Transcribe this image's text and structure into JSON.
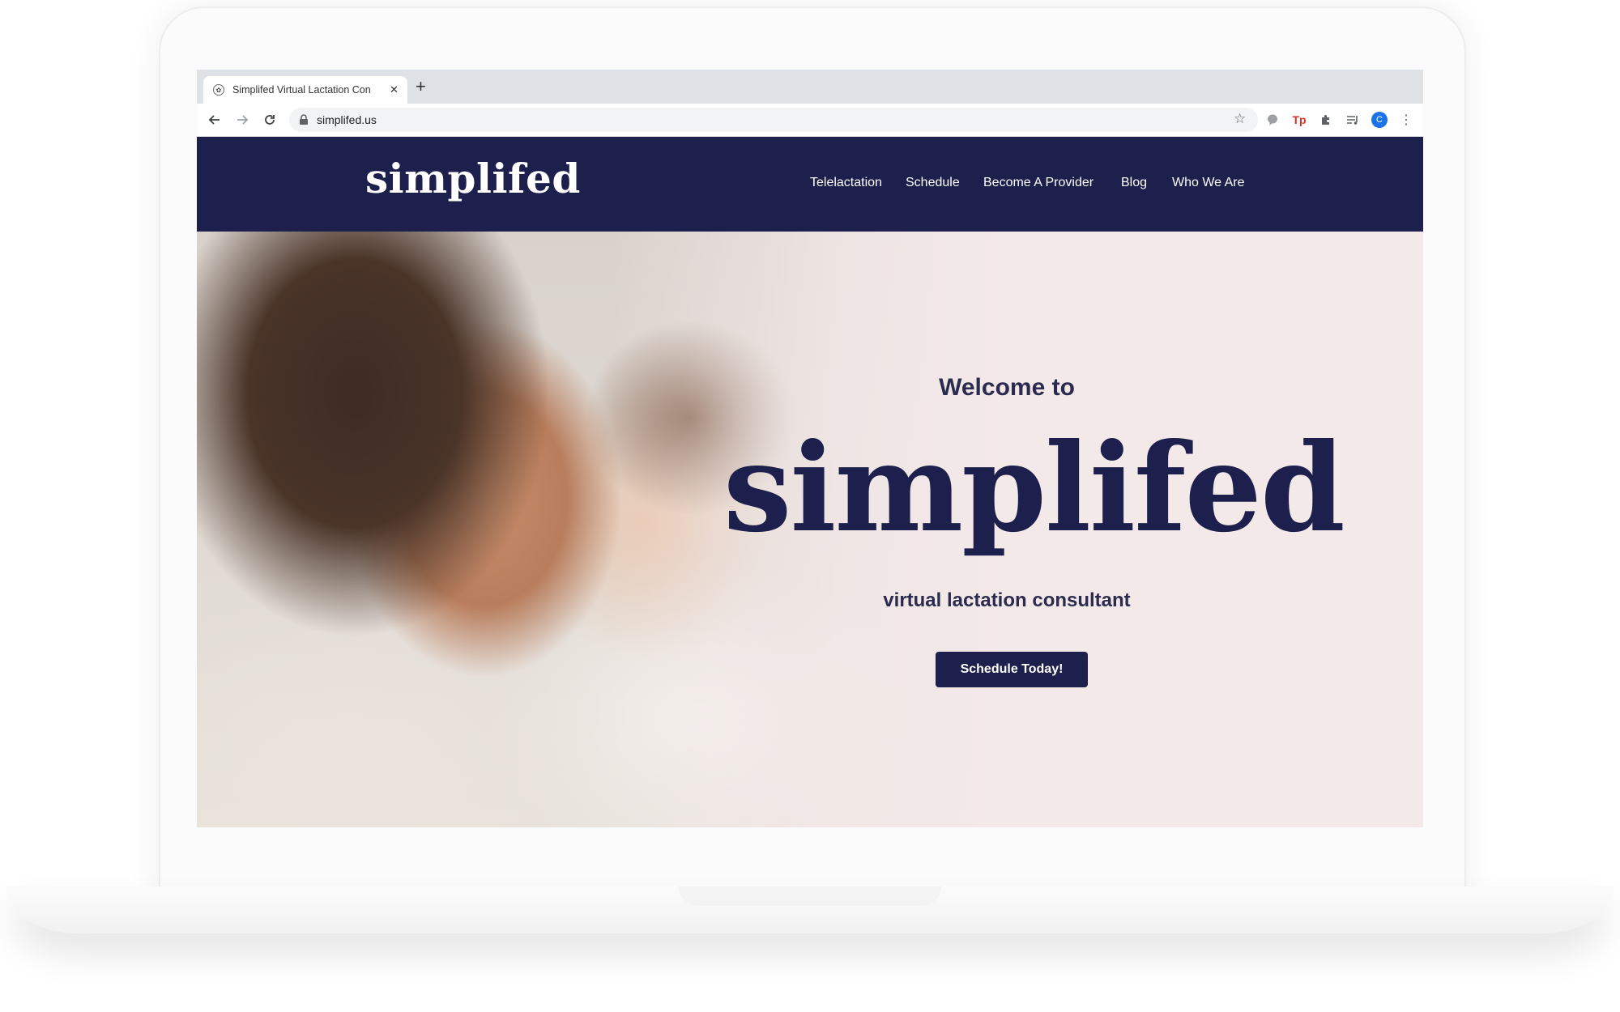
{
  "browser": {
    "tab_title": "Simplifed Virtual Lactation Con",
    "tab_close_glyph": "✕",
    "new_tab_glyph": "+",
    "url": "simplifed.us",
    "profile_initial": "C",
    "extensions": [
      "chat-bubble-icon",
      "tp-extension-icon",
      "puzzle-extensions-icon",
      "reading-list-icon"
    ],
    "tp_label": "Tp"
  },
  "site": {
    "logo": "simplifed",
    "nav": [
      "Telelactation",
      "Schedule",
      "Become A Provider",
      "Blog",
      "Who We Are"
    ],
    "hero": {
      "welcome": "Welcome to",
      "brand": "simplifed",
      "tagline": "virtual lactation consultant",
      "cta": "Schedule Today!"
    },
    "colors": {
      "navy": "#1d1f4c",
      "hero_background": "#f4e9e9"
    }
  }
}
